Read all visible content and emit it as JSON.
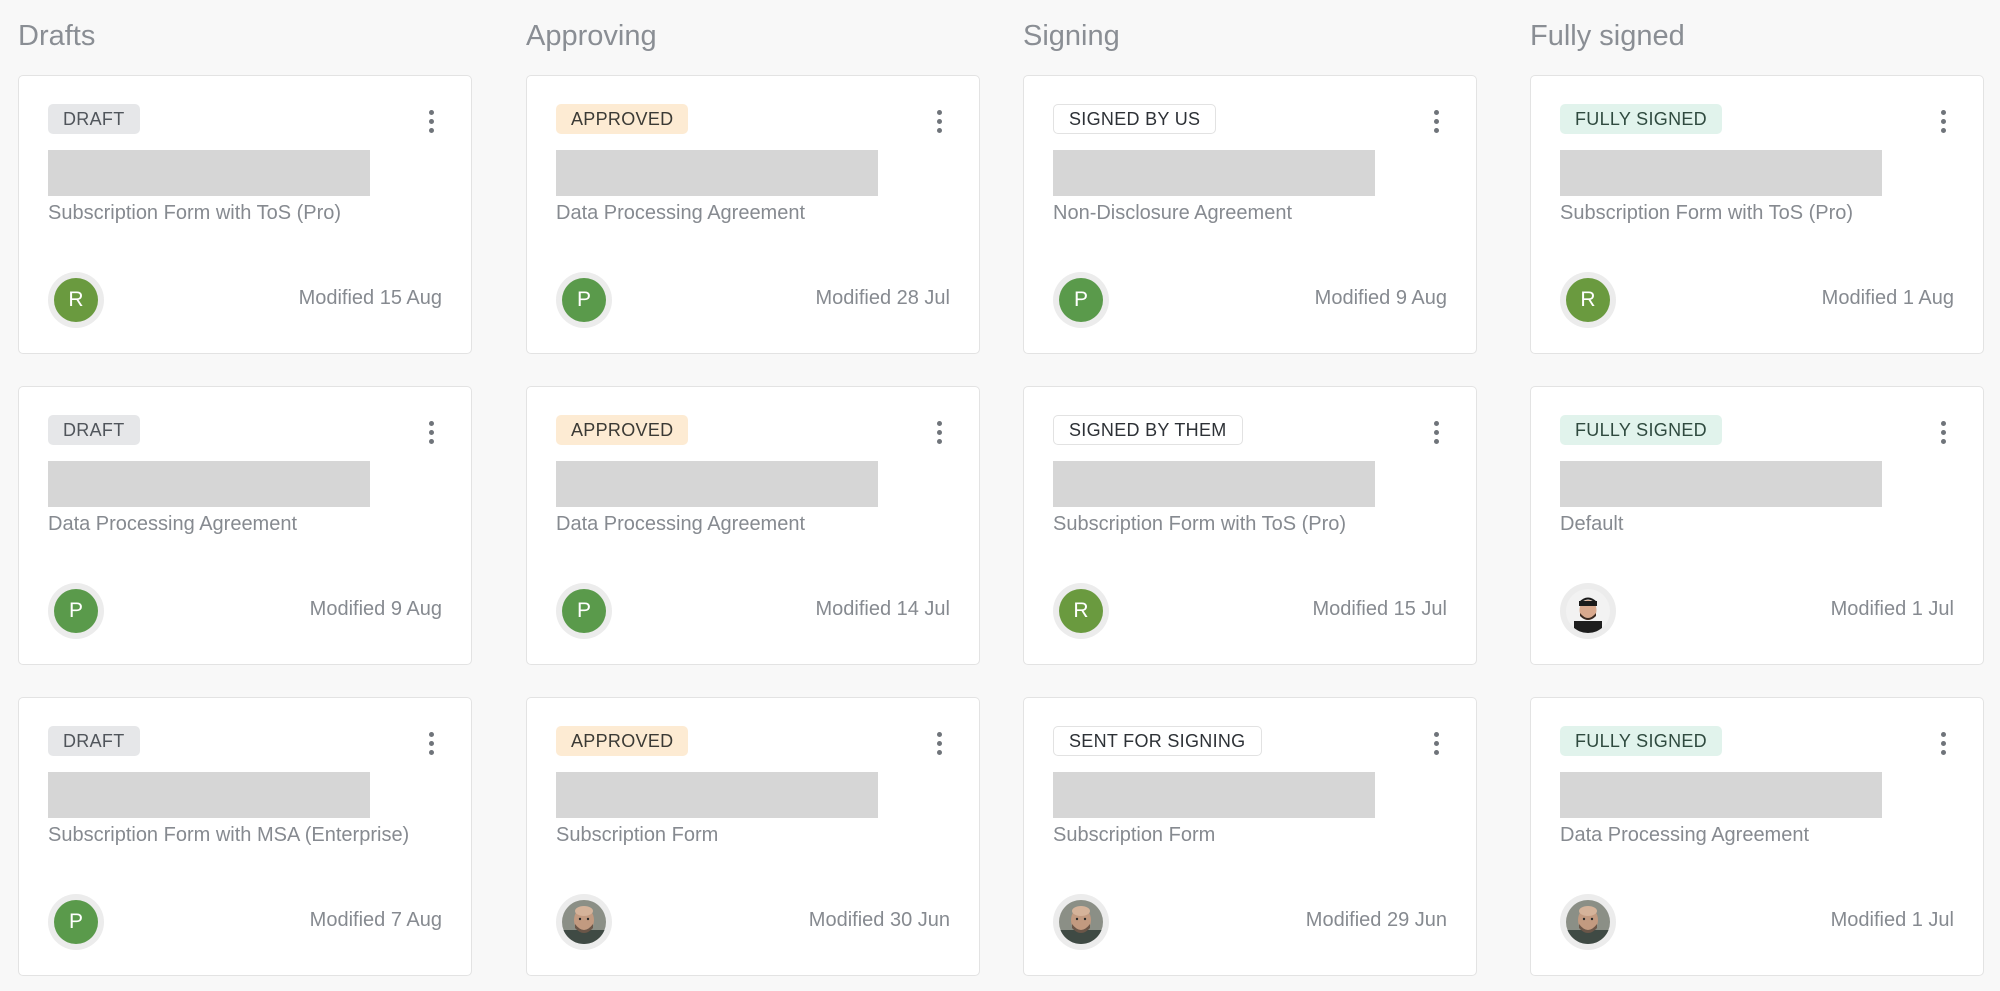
{
  "board": {
    "columns": [
      {
        "title": "Drafts",
        "cards": [
          {
            "status": "DRAFT",
            "document": "Subscription Form with ToS (Pro)",
            "avatar": "R",
            "modified": "Modified 15 Aug"
          },
          {
            "status": "DRAFT",
            "document": "Data Processing Agreement",
            "avatar": "P",
            "modified": "Modified 9 Aug"
          },
          {
            "status": "DRAFT",
            "document": "Subscription Form with MSA (Enterprise)",
            "avatar": "P",
            "modified": "Modified 7 Aug"
          }
        ]
      },
      {
        "title": "Approving",
        "cards": [
          {
            "status": "APPROVED",
            "document": "Data Processing Agreement",
            "avatar": "P",
            "modified": "Modified 28 Jul"
          },
          {
            "status": "APPROVED",
            "document": "Data Processing Agreement",
            "avatar": "P",
            "modified": "Modified 14 Jul"
          },
          {
            "status": "APPROVED",
            "document": "Subscription Form",
            "avatar": "photo-bald-man",
            "modified": "Modified 30 Jun"
          }
        ]
      },
      {
        "title": "Signing",
        "cards": [
          {
            "status": "SIGNED BY US",
            "document": "Non-Disclosure Agreement",
            "avatar": "P",
            "modified": "Modified 9 Aug"
          },
          {
            "status": "SIGNED BY THEM",
            "document": "Subscription Form with ToS (Pro)",
            "avatar": "R",
            "modified": "Modified 15 Jul"
          },
          {
            "status": "SENT FOR SIGNING",
            "document": "Subscription Form",
            "avatar": "photo-bald-man",
            "modified": "Modified 29 Jun"
          }
        ]
      },
      {
        "title": "Fully signed",
        "cards": [
          {
            "status": "FULLY SIGNED",
            "document": "Subscription Form with ToS (Pro)",
            "avatar": "R",
            "modified": "Modified 1 Aug"
          },
          {
            "status": "FULLY SIGNED",
            "document": "Default",
            "avatar": "photo-dark-hair-man",
            "modified": "Modified 1 Jul"
          },
          {
            "status": "FULLY SIGNED",
            "document": "Data Processing Agreement",
            "avatar": "photo-bald-man",
            "modified": "Modified 1 Jul"
          }
        ]
      }
    ]
  },
  "colors": {
    "avatar_p": "#5a9a4b",
    "avatar_r": "#6a9a3f",
    "draft_badge": "#e6e7e9",
    "approved_badge": "#fdebd3",
    "fully_signed_badge": "#e1f3ec",
    "placeholder": "#d6d6d6"
  },
  "icons": {
    "menu": "more-vertical-icon"
  }
}
